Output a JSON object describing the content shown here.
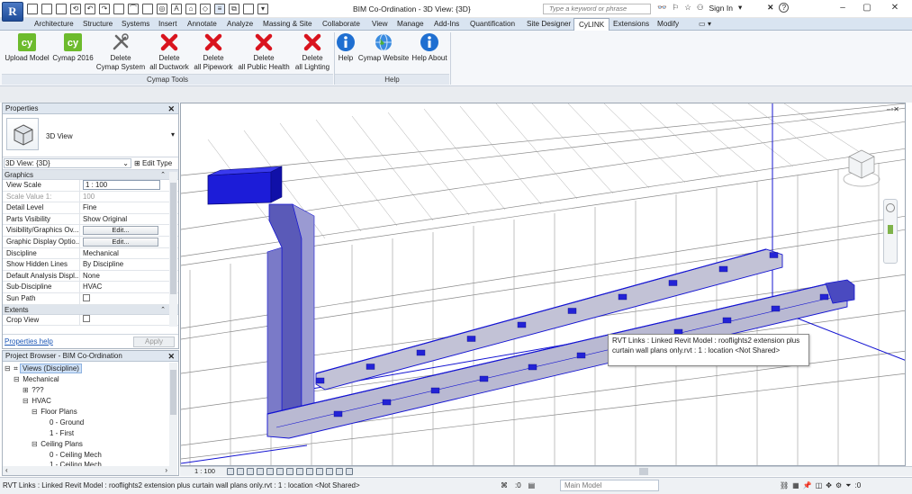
{
  "titlebar": {
    "app_letter": "R",
    "title": "BIM Co-Ordination - 3D View: {3D}",
    "search_placeholder": "Type a keyword or phrase",
    "sign_in": "Sign In",
    "minimize": "–",
    "maximize": "▢",
    "close": "✕"
  },
  "tabs": [
    "Architecture",
    "Structure",
    "Systems",
    "Insert",
    "Annotate",
    "Analyze",
    "Massing & Site",
    "Collaborate",
    "View",
    "Manage",
    "Add-Ins",
    "Quantification",
    "Site Designer",
    "CyLINK",
    "Extensions",
    "Modify"
  ],
  "active_tab": "CyLINK",
  "ribbon": {
    "buttons": [
      {
        "label1": "Upload Model",
        "label2": "",
        "icon": "cymap-cy-icon"
      },
      {
        "label1": "Cymap 2016",
        "label2": "",
        "icon": "cymap-cy-icon"
      },
      {
        "label1": "Delete",
        "label2": "Cymap System",
        "icon": "tools-icon"
      },
      {
        "label1": "Delete",
        "label2": "all Ductwork",
        "icon": "red-x-icon"
      },
      {
        "label1": "Delete",
        "label2": "all Pipework",
        "icon": "red-x-icon"
      },
      {
        "label1": "Delete",
        "label2": "all Public Health",
        "icon": "red-x-icon"
      },
      {
        "label1": "Delete",
        "label2": "all Lighting",
        "icon": "red-x-icon"
      },
      {
        "label1": "Help",
        "label2": "",
        "icon": "info-icon"
      },
      {
        "label1": "Cymap Website",
        "label2": "",
        "icon": "globe-icon"
      },
      {
        "label1": "Help About",
        "label2": "",
        "icon": "info-icon"
      }
    ],
    "groups": [
      "Cymap Tools",
      "Help"
    ]
  },
  "properties": {
    "title": "Properties",
    "type_name": "3D View",
    "filter": "3D View: {3D}",
    "edit_type": "Edit Type",
    "sections": {
      "graphics": "Graphics",
      "extents": "Extents"
    },
    "rows": [
      {
        "k": "View Scale",
        "v": "1 : 100"
      },
      {
        "k": "Scale Value    1:",
        "v": "100"
      },
      {
        "k": "Detail Level",
        "v": "Fine"
      },
      {
        "k": "Parts Visibility",
        "v": "Show Original"
      },
      {
        "k": "Visibility/Graphics Ov...",
        "v": "Edit..."
      },
      {
        "k": "Graphic Display Optio...",
        "v": "Edit..."
      },
      {
        "k": "Discipline",
        "v": "Mechanical"
      },
      {
        "k": "Show Hidden Lines",
        "v": "By Discipline"
      },
      {
        "k": "Default Analysis Displ...",
        "v": "None"
      },
      {
        "k": "Sub-Discipline",
        "v": "HVAC"
      },
      {
        "k": "Sun Path",
        "v": ""
      }
    ],
    "extent_rows": [
      {
        "k": "Crop View",
        "v": ""
      }
    ],
    "help_link": "Properties help",
    "apply": "Apply"
  },
  "browser": {
    "title": "Project Browser - BIM Co-Ordination",
    "nodes": [
      {
        "label": "Views (Discipline)",
        "exp": "⊟",
        "indent": 0
      },
      {
        "label": "Mechanical",
        "exp": "⊟",
        "indent": 1
      },
      {
        "label": "???",
        "exp": "⊞",
        "indent": 2
      },
      {
        "label": "HVAC",
        "exp": "⊟",
        "indent": 2
      },
      {
        "label": "Floor Plans",
        "exp": "⊟",
        "indent": 3
      },
      {
        "label": "0 - Ground",
        "exp": "",
        "indent": 4
      },
      {
        "label": "1 - First",
        "exp": "",
        "indent": 4
      },
      {
        "label": "Ceiling Plans",
        "exp": "⊟",
        "indent": 3
      },
      {
        "label": "0 - Ceiling Mech",
        "exp": "",
        "indent": 4
      },
      {
        "label": "1 - Ceiling Mech",
        "exp": "",
        "indent": 4
      }
    ]
  },
  "viewport": {
    "tooltip": "RVT Links : Linked Revit Model : rooflights2 extension plus curtain wall plans only.rvt : 1 : location <Not Shared>",
    "window_controls": "–▫✕"
  },
  "viewbar": {
    "scale": "1 : 100"
  },
  "statusbar": {
    "message": "RVT Links : Linked Revit Model : rooflights2 extension plus curtain wall plans only.rvt : 1 : location <Not Shared>",
    "zero": ":0",
    "model": "Main Model"
  },
  "colors": {
    "duct_blue": "#1414d2",
    "ribbon_tab_bg": "#d9e4f1",
    "red_x": "#d9141e",
    "cymap_green": "#6dbb2d",
    "info_blue": "#1f6fd1"
  }
}
